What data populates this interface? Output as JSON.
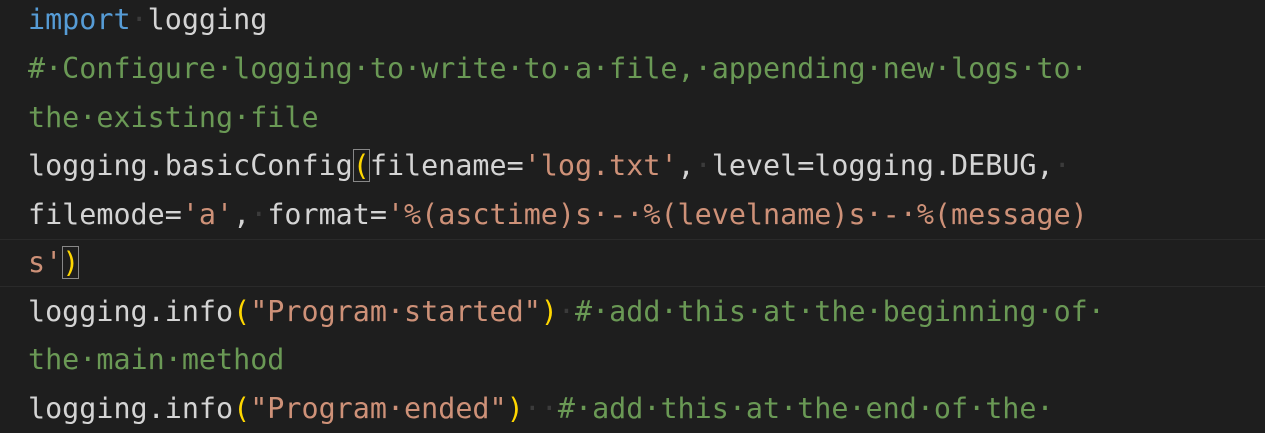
{
  "editor": {
    "lines": [
      [
        {
          "t": "import",
          "c": "kw"
        },
        {
          "t": "·",
          "c": "ws"
        },
        {
          "t": "logging",
          "c": "id"
        }
      ],
      [
        {
          "t": "#·Configure·logging·to·write·to·a·file,·appending·new·logs·to·",
          "c": "cm"
        }
      ],
      [
        {
          "t": "the·existing·file",
          "c": "cm"
        }
      ],
      [
        {
          "t": "logging.basicConfig",
          "c": "id"
        },
        {
          "t": "(",
          "c": "br",
          "m": true
        },
        {
          "t": "filename=",
          "c": "id"
        },
        {
          "t": "'log.txt'",
          "c": "st"
        },
        {
          "t": ",",
          "c": "id"
        },
        {
          "t": "·",
          "c": "ws"
        },
        {
          "t": "level=logging.DEBUG,",
          "c": "id"
        },
        {
          "t": "·",
          "c": "ws"
        }
      ],
      [
        {
          "t": "filemode=",
          "c": "id"
        },
        {
          "t": "'a'",
          "c": "st"
        },
        {
          "t": ",",
          "c": "id"
        },
        {
          "t": "·",
          "c": "ws"
        },
        {
          "t": "format=",
          "c": "id"
        },
        {
          "t": "'%(asctime)s·-·%(levelname)s·-·%(message)",
          "c": "st"
        }
      ],
      [
        {
          "t": "s'",
          "c": "st"
        },
        {
          "t": ")",
          "c": "br",
          "m": true
        }
      ],
      [
        {
          "t": "logging.info",
          "c": "id"
        },
        {
          "t": "(",
          "c": "br"
        },
        {
          "t": "\"Program·started\"",
          "c": "st"
        },
        {
          "t": ")",
          "c": "br"
        },
        {
          "t": "·",
          "c": "ws"
        },
        {
          "t": "#·add·this·at·the·beginning·of·",
          "c": "cm"
        }
      ],
      [
        {
          "t": "the·main·method",
          "c": "cm"
        }
      ],
      [
        {
          "t": "logging.info",
          "c": "id"
        },
        {
          "t": "(",
          "c": "br"
        },
        {
          "t": "\"Program·ended\"",
          "c": "st"
        },
        {
          "t": ")",
          "c": "br"
        },
        {
          "t": "··",
          "c": "ws"
        },
        {
          "t": "#·add·this·at·the·end·of·the·",
          "c": "cm"
        }
      ]
    ]
  },
  "colors": {
    "background": "#1e1e1e",
    "keyword": "#569cd6",
    "identifier": "#d4d4d4",
    "comment": "#6a9955",
    "string": "#ce9178",
    "bracket": "#ffd700",
    "whitespace": "#3b3b3b"
  }
}
